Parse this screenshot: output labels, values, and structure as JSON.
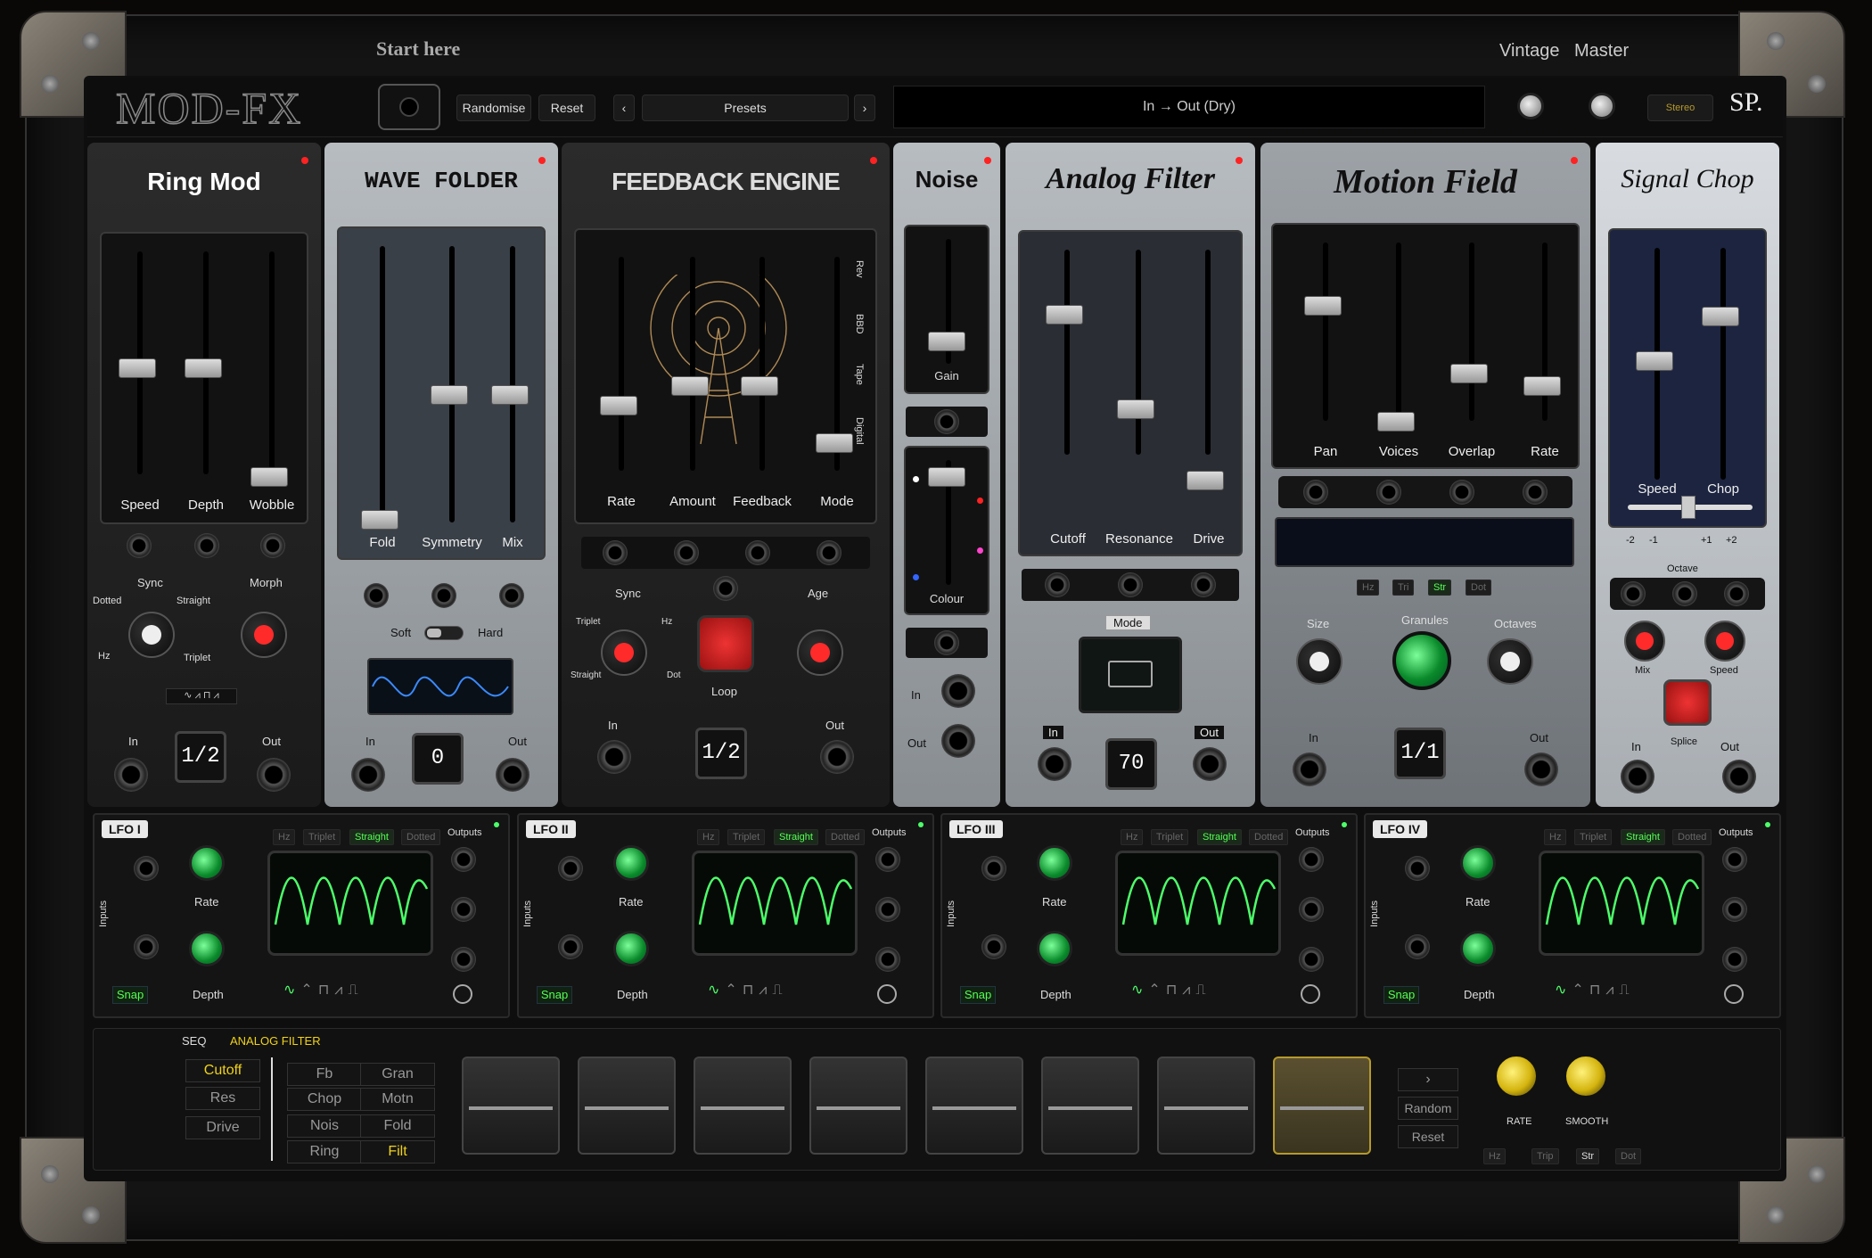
{
  "header": {
    "start_here": "Start here",
    "vintage": "Vintage",
    "master": "Master",
    "logo": "MOD-FX"
  },
  "toolbar": {
    "randomise": "Randomise",
    "reset": "Reset",
    "presets": "Presets",
    "routing": "In → Out (Dry)",
    "stereo": "Stereo",
    "brand": "SP."
  },
  "modules": {
    "ringmod": {
      "title": "Ring Mod",
      "sliders": [
        "Speed",
        "Depth",
        "Wobble"
      ],
      "sync": "Sync",
      "dotted": "Dotted",
      "straight": "Straight",
      "hz": "Hz",
      "triplet": "Triplet",
      "morph": "Morph",
      "in": "In",
      "out": "Out",
      "value": "1/2"
    },
    "wavefolder": {
      "title": "WAVE FOLDER",
      "sliders": [
        "Fold",
        "Symmetry",
        "Mix"
      ],
      "soft": "Soft",
      "hard": "Hard",
      "in": "In",
      "out": "Out",
      "value": "0"
    },
    "feedback": {
      "title": "FEEDBACK ENGINE",
      "sliders": [
        "Rate",
        "Amount",
        "Feedback",
        "Mode"
      ],
      "modes": [
        "Rev",
        "BBD",
        "Tape",
        "Digital"
      ],
      "sync": "Sync",
      "triplet": "Triplet",
      "hz": "Hz",
      "straight": "Straight",
      "dot": "Dot",
      "loop": "Loop",
      "age": "Age",
      "in": "In",
      "out": "Out",
      "value": "1/2"
    },
    "noise": {
      "title": "Noise",
      "gain": "Gain",
      "colour": "Colour",
      "in": "In",
      "out": "Out"
    },
    "analog": {
      "title": "Analog Filter",
      "sliders": [
        "Cutoff",
        "Resonance",
        "Drive"
      ],
      "mode": "Mode",
      "in": "In",
      "out": "Out",
      "value": "70"
    },
    "motion": {
      "title": "Motion Field",
      "sliders": [
        "Pan",
        "Voices",
        "Overlap",
        "Rate"
      ],
      "chips": [
        "Hz",
        "Tri",
        "Str",
        "Dot"
      ],
      "size": "Size",
      "granules": "Granules",
      "octaves": "Octaves",
      "in": "In",
      "out": "Out",
      "value": "1/1"
    },
    "chop": {
      "title": "Signal Chop",
      "sliders": [
        "Speed",
        "Chop"
      ],
      "octave_marks": [
        "-2",
        "-1",
        "+1",
        "+2"
      ],
      "octave": "Octave",
      "mix": "Mix",
      "speed": "Speed",
      "splice": "Splice",
      "in": "In",
      "out": "Out"
    }
  },
  "lfos": [
    {
      "tag": "LFO I"
    },
    {
      "tag": "LFO II"
    },
    {
      "tag": "LFO III"
    },
    {
      "tag": "LFO IV"
    }
  ],
  "lfo_common": {
    "chips": [
      "Hz",
      "Triplet",
      "Straight",
      "Dotted"
    ],
    "outputs": "Outputs",
    "inputs": "Inputs",
    "rate": "Rate",
    "depth": "Depth",
    "snap": "Snap"
  },
  "seq": {
    "label": "SEQ",
    "target": "ANALOG FILTER",
    "params": [
      "Cutoff",
      "Res",
      "Drive"
    ],
    "mods": [
      "Fb",
      "Gran",
      "Chop",
      "Motn",
      "Nois",
      "Fold",
      "Ring",
      "Filt"
    ],
    "next": "›",
    "random": "Random",
    "reset": "Reset",
    "rate": "RATE",
    "smooth": "SMOOTH",
    "chips": [
      "Hz",
      "Trip",
      "Str",
      "Dot"
    ]
  },
  "colors": {
    "accent_green": "#4dff6a",
    "accent_yellow": "#f0d21a",
    "red_knob": "#ff2a2a"
  }
}
